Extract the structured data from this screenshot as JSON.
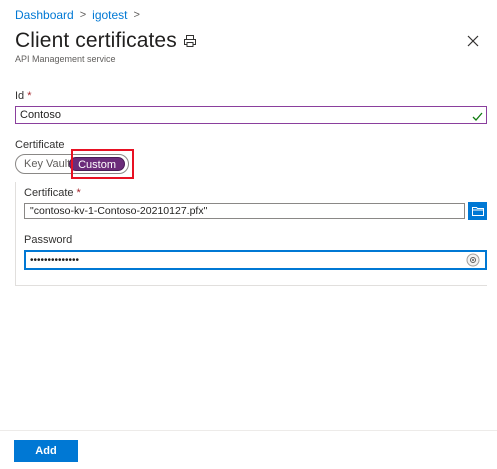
{
  "breadcrumb": {
    "items": [
      "Dashboard",
      "igotest"
    ],
    "separator": ">"
  },
  "header": {
    "title": "Client certificates",
    "subtitle": "API Management service"
  },
  "form": {
    "id_label": "Id",
    "id_required_mark": "*",
    "id_value": "Contoso",
    "certificate_section_label": "Certificate",
    "source_options": [
      "Key Vault",
      "Custom"
    ],
    "source_selected": "Custom",
    "certificate_file_label": "Certificate",
    "certificate_required_mark": "*",
    "certificate_file_value": "\"contoso-kv-1-Contoso-20210127.pfx\"",
    "password_label": "Password",
    "password_value": "••••••••••••••"
  },
  "footer": {
    "add_label": "Add"
  },
  "colors": {
    "accent": "#0078d4",
    "toggle_selected": "#6b2c7a",
    "highlight_border": "#e81123",
    "valid_check": "#107c10"
  }
}
